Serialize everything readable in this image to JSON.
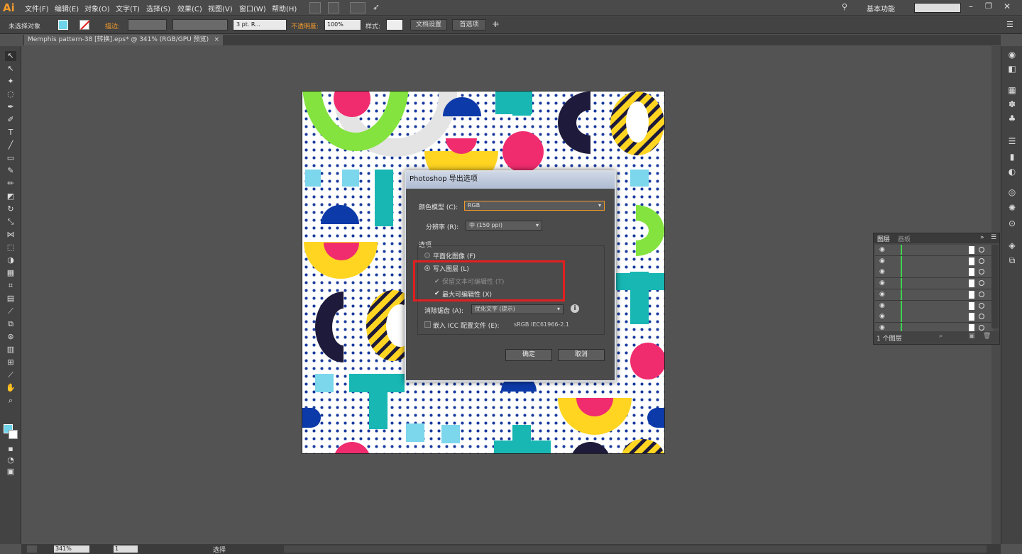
{
  "app": {
    "logo": "Ai"
  },
  "menu": [
    "文件(F)",
    "编辑(E)",
    "对象(O)",
    "文字(T)",
    "选择(S)",
    "效果(C)",
    "视图(V)",
    "窗口(W)",
    "帮助(H)"
  ],
  "workspace": {
    "label": "基本功能"
  },
  "control_bar": {
    "selection_label": "未选择对象",
    "stroke_label": "描边:",
    "brush_value": "3 pt. R...",
    "opacity_label": "不透明度:",
    "opacity_value": "100%",
    "style_label": "样式:",
    "doc_setup_button": "文档设置",
    "preferences_button": "首选项"
  },
  "document_tab": {
    "title": "Memphis pattern-38 [转换].eps* @ 341% (RGB/GPU 预览)"
  },
  "dialog": {
    "title": "Photoshop 导出选项",
    "color_model_label": "颜色模型 (C):",
    "color_model_value": "RGB",
    "resolution_label": "分辨率 (R):",
    "resolution_value": "中 (150 ppi)",
    "options_group": "选项",
    "flat_image_label": "平面化图像 (F)",
    "write_layers_label": "写入图层 (L)",
    "preserve_text_label": "保留文本可编辑性 (T)",
    "max_edit_label": "最大可编辑性 (X)",
    "antialias_label": "消除锯齿 (A):",
    "antialias_value": "优化文字 (提示)",
    "embed_icc_label": "嵌入 ICC 配置文件 (E):",
    "icc_value": "sRGB IEC61966-2.1",
    "ok_button": "确定",
    "cancel_button": "取消"
  },
  "layers_panel": {
    "tabs": [
      "图层",
      "画板"
    ],
    "footer": "1 个图层",
    "row_count": 8
  },
  "status_bar": {
    "zoom": "341%",
    "page": "1",
    "mode": "选择"
  },
  "colors": {
    "accent_orange": "#f29a2b",
    "fill_swatch": "#6fd3ea",
    "redbox": "#e21f1f"
  }
}
